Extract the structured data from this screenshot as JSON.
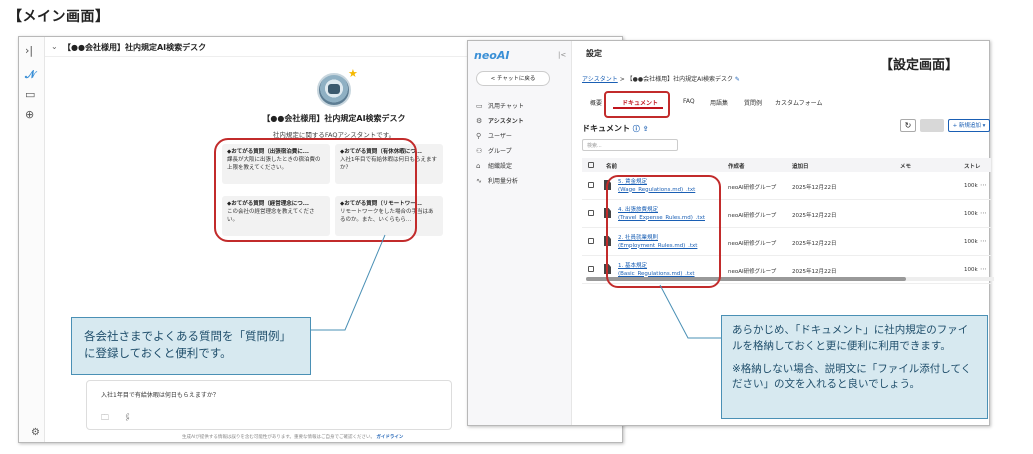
{
  "header": {
    "main_label": "【メイン画面】"
  },
  "chat": {
    "rail_icons": [
      "expand-icon",
      "logo-icon",
      "chat-icon",
      "assistant-icon"
    ],
    "title": "【●●会社様用】社内規定AI検索デスク",
    "assistant_name": "【●●会社様用】社内規定AI検索デスク",
    "assistant_desc": "社内規定に関するFAQアシスタントです。",
    "faq": [
      {
        "title": "◆おてがる質問（出張宿泊費に...",
        "body": "課長が大阪に出張したときの宿泊費の上限を教えてください。"
      },
      {
        "title": "◆おてがる質問（有休休暇につ...",
        "body": "入社1年目で有給休暇は何日もらえますか？"
      },
      {
        "title": "◆おてがる質問（経営理念につ...",
        "body": "この会社の経営理念を教えてください。"
      },
      {
        "title": "◆おてがる質問（リモートワー...",
        "body": "リモートワークをした場合の手当はあるのか。また、いくらもら..."
      }
    ],
    "input_text": "入社1年目で有給休暇は何日もらえますか？",
    "input_icons": "🗀 🖇",
    "disclaimer": "生成AIが提供する情報は誤りを含む可能性があります。重要な情報はご自身でご確認ください。",
    "guide_link": "ガイドライン",
    "callout": "各会社さまでよくある質問を「質問例」に登録しておくと便利です。"
  },
  "settings": {
    "logo": "neoAI",
    "back_label": "< チャットに戻る",
    "nav": [
      {
        "icon": "▭",
        "label": "汎用チャット"
      },
      {
        "icon": "⚙",
        "label": "アシスタント"
      },
      {
        "icon": "⚲",
        "label": "ユーザー"
      },
      {
        "icon": "⚇",
        "label": "グループ"
      },
      {
        "icon": "⌂",
        "label": "組織設定"
      },
      {
        "icon": "∿",
        "label": "利用量分析"
      }
    ],
    "title": "設定",
    "screen_label": "【設定画面】",
    "breadcrumb": {
      "root": "アシスタント",
      "sep": ">",
      "current": "【●●会社様用】社内規定AI検索デスク"
    },
    "tabs": [
      "概要",
      "ドキュメント",
      "FAQ",
      "用語集",
      "質問例",
      "カスタムフォーム"
    ],
    "active_tab": "ドキュメント",
    "doc_heading": "ドキュメント",
    "add_button": "+ 新規追加 ▾",
    "search_placeholder": "検索...",
    "columns": [
      "名前",
      "作成者",
      "追加日",
      "メモ",
      "ストレ"
    ],
    "rows": [
      {
        "name1": "5. 賃金規定",
        "name2": "(Wage_Regulations.md)_.txt",
        "creator": "neoAI研修グループ",
        "date": "2025年12月22日",
        "size": "100k"
      },
      {
        "name1": "4. 出張旅費規定",
        "name2": "(Travel_Expense_Rules.md)_.txt",
        "creator": "neoAI研修グループ",
        "date": "2025年12月22日",
        "size": "100k"
      },
      {
        "name1": "2. 社員就業規則",
        "name2": "(Employment_Rules.md)_.txt",
        "creator": "neoAI研修グループ",
        "date": "2025年12月22日",
        "size": "100k"
      },
      {
        "name1": "1. 基本規定",
        "name2": "(Basic_Regulations.md)_.txt",
        "creator": "neoAI研修グループ",
        "date": "2025年12月22日",
        "size": "100k"
      }
    ],
    "callout": "あらかじめ、「ドキュメント」に社内規定のファイルを格納しておくと更に便利に利用できます。",
    "callout_note": "※格納しない場合、説明文に「ファイル添付してください」の文を入れると良いでしょう。"
  },
  "colors": {
    "highlight_red": "#c22b2b",
    "callout_bg": "#d7e9f0",
    "link_blue": "#1a5fb4"
  }
}
